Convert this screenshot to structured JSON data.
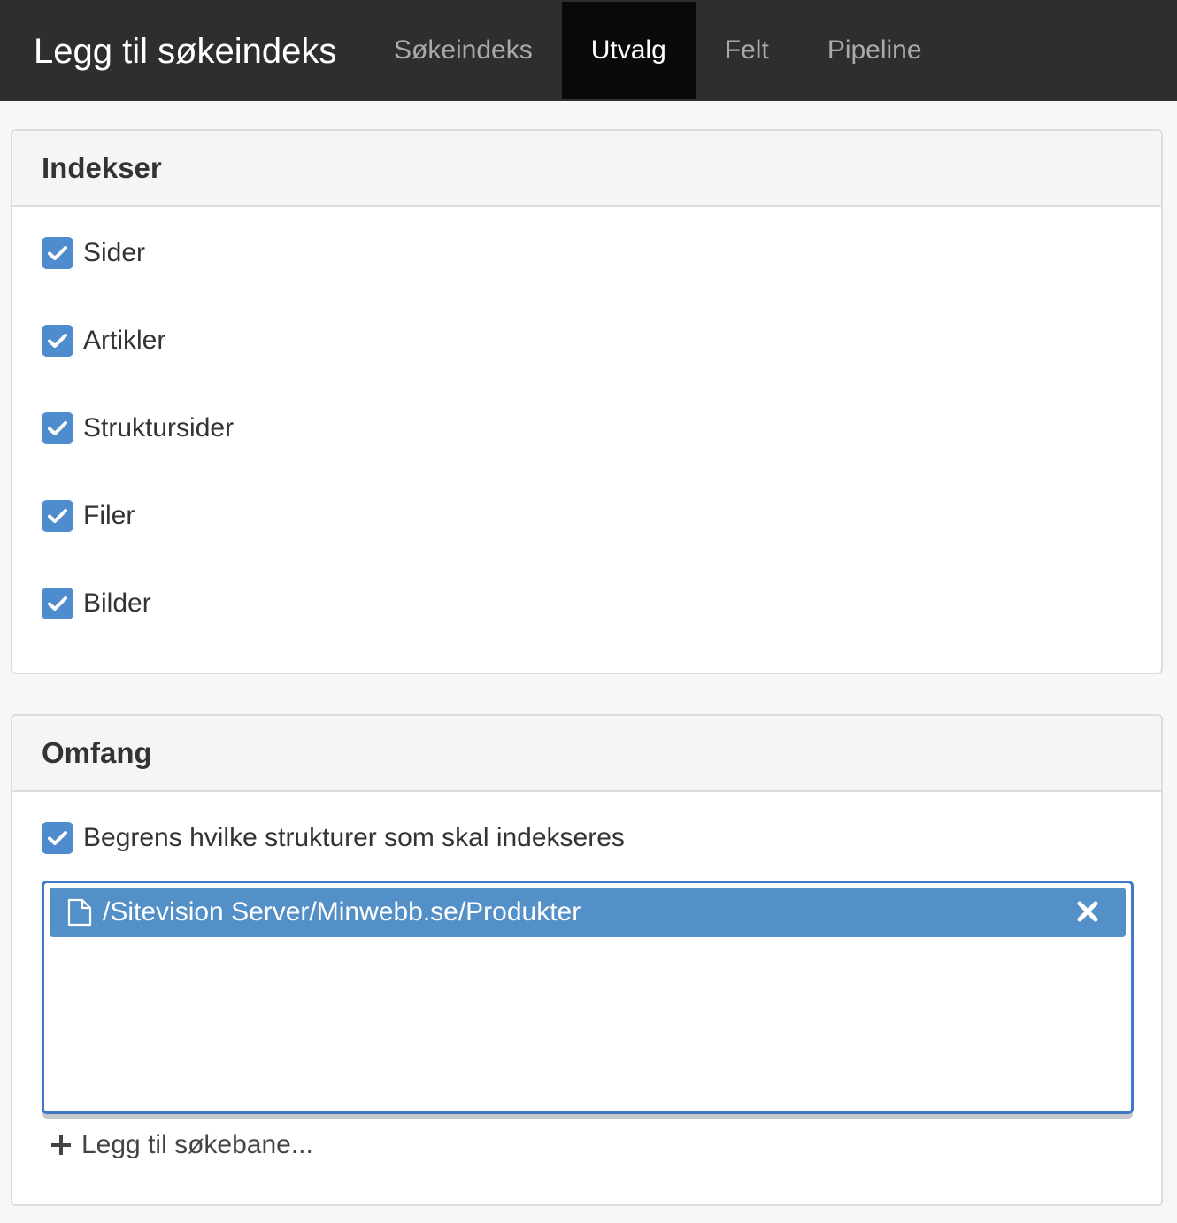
{
  "header": {
    "title": "Legg til søkeindeks",
    "tabs": [
      {
        "label": "Søkeindeks",
        "active": false
      },
      {
        "label": "Utvalg",
        "active": true
      },
      {
        "label": "Felt",
        "active": false
      },
      {
        "label": "Pipeline",
        "active": false
      }
    ]
  },
  "indexes": {
    "title": "Indekser",
    "items": [
      {
        "label": "Sider",
        "checked": true
      },
      {
        "label": "Artikler",
        "checked": true
      },
      {
        "label": "Struktursider",
        "checked": true
      },
      {
        "label": "Filer",
        "checked": true
      },
      {
        "label": "Bilder",
        "checked": true
      }
    ]
  },
  "scope": {
    "title": "Omfang",
    "restrict_label": "Begrens hvilke strukturer som skal indekseres",
    "restrict_checked": true,
    "paths": [
      {
        "path": "/Sitevision Server/Minwebb.se/Produkter",
        "icon": "file-icon"
      }
    ],
    "add_label": "Legg til søkebane..."
  },
  "colors": {
    "topbar": "#2e2e2e",
    "active_tab": "#0a0a0a",
    "checkbox": "#4f8ccd",
    "selected_path": "#5490c8",
    "focus_border": "#3f78c7"
  }
}
